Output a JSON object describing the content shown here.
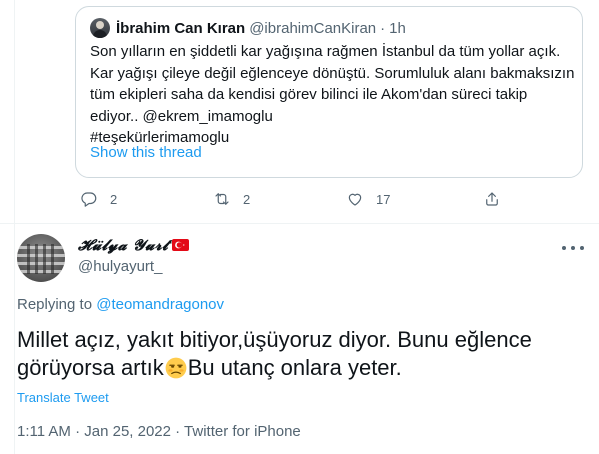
{
  "quoted_tweet": {
    "author_name": "İbrahim Can Kıran",
    "author_handle": "@ibrahimCanKiran",
    "separator": "·",
    "time": "1h",
    "lines": [
      "Son yılların en şiddetli kar yağışına rağmen İstanbul da tüm yollar açık.",
      "Kar yağışı çileye değil eğlenceye dönüştü. Sorumluluk alanı bakmaksızın",
      "tüm ekipleri saha da kendisi görev bilinci ile Akom'dan süreci takip",
      "ediyor.. @ekrem_imamoglu",
      "#teşekürlerimamoglu"
    ],
    "show_thread": "Show this thread"
  },
  "actions": {
    "reply_count": "2",
    "retweet_count": "2",
    "like_count": "17",
    "icons": [
      "reply-icon",
      "retweet-icon",
      "like-icon",
      "share-icon"
    ]
  },
  "tweet": {
    "display_name": "𝓗𝓾̈𝓵𝔂𝓪 𝓨𝓾𝓻𝓽",
    "handle": "@hulyayurt_",
    "replying_prefix": "Replying to",
    "replying_to": "@teomandragonov",
    "text_line1": "Millet açız, yakıt bitiyor,üşüyoruz diyor. Bunu eğlence",
    "text_line2a": "görüyorsa artık",
    "text_line2b": "Bu utanç onlara yeter.",
    "translate": "Translate Tweet",
    "timestamp": "1:11 AM · Jan 25, 2022 · Twitter for iPhone"
  },
  "colors": {
    "link": "#1d9bf0",
    "secondary_text": "#536471",
    "primary_text": "#0f1419",
    "border": "#cfd9de",
    "flag": "#e30a17"
  }
}
